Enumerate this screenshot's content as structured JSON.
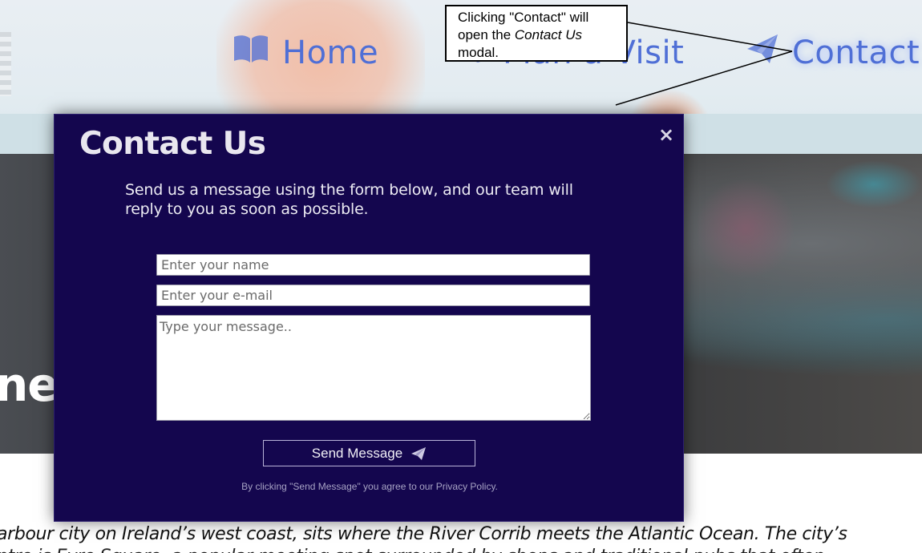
{
  "nav": {
    "items": [
      {
        "label": "Home",
        "icon": "book-open-icon"
      },
      {
        "label": "Plan a Visit",
        "icon": "map-icon"
      },
      {
        "label": "Contact",
        "icon": "paper-plane-icon"
      }
    ],
    "accent": "#4f6fd6"
  },
  "annotation": {
    "text_before": "Clicking \"Contact\" will open the ",
    "text_em": "Contact Us",
    "text_after": " modal."
  },
  "hero": {
    "title_fragment": "ne t"
  },
  "intro": {
    "line1": "arbour city on Ireland’s west coast, sits where the River Corrib meets the Atlantic Ocean. The city’s",
    "line2": "                    ntre is Eyre Square, a popular meeting spot surrounded by shops and traditional pubs that often"
  },
  "modal": {
    "title": "Contact Us",
    "close_label": "×",
    "description": "Send us a message using the form below, and our team will reply to you as soon as possible.",
    "name_placeholder": "Enter your name",
    "email_placeholder": "Enter your e-mail",
    "message_placeholder": "Type your message..",
    "send_label": "Send Message",
    "disclaimer": "By clicking \"Send Message\" you agree to our Privacy Policy.",
    "background": "#14064e"
  }
}
